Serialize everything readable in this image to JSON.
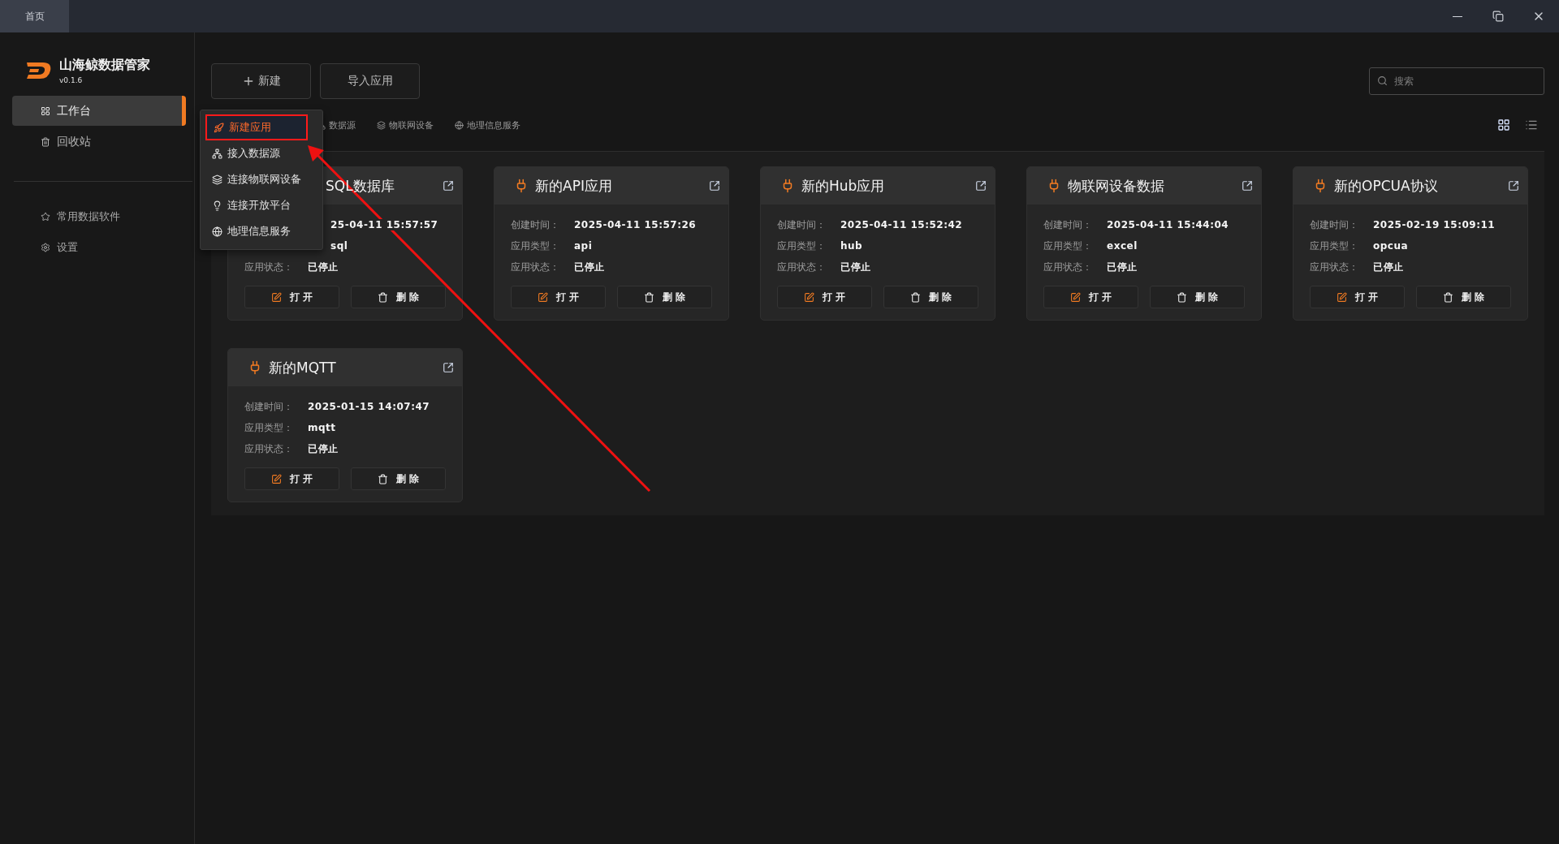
{
  "titlebar": {
    "tabs": [
      {
        "label": "首页",
        "selected": true
      }
    ]
  },
  "sidebar": {
    "app_name": "山海鲸数据管家",
    "version": "v0.1.6",
    "items": [
      {
        "label": "工作台",
        "selected": true
      },
      {
        "label": "回收站",
        "selected": false
      }
    ],
    "bottom_items": [
      {
        "label": "常用数据软件"
      },
      {
        "label": "设置"
      }
    ]
  },
  "toolbar": {
    "buttons": [
      {
        "label": "新建"
      },
      {
        "label": "导入应用"
      }
    ],
    "search": {
      "placeholder": "搜索"
    }
  },
  "filters": [
    {
      "label": "数据源"
    },
    {
      "label": "物联网设备"
    },
    {
      "label": "地理信息服务"
    }
  ],
  "view_modes": [
    {
      "selected": true
    },
    {
      "selected": false
    }
  ],
  "dropdown": {
    "items": [
      {
        "label": "新建应用",
        "selected": true,
        "outlined": true
      },
      {
        "label": "接入数据源",
        "selected": false,
        "outlined": false
      },
      {
        "label": "连接物联网设备",
        "selected": false,
        "outlined": false
      },
      {
        "label": "连接开放平台",
        "selected": false,
        "outlined": false
      },
      {
        "label": "地理信息服务",
        "selected": false,
        "outlined": false
      }
    ]
  },
  "cards": [
    {
      "title": "SQL数据库",
      "rows": [
        {
          "value": "25-04-11 15:57:57"
        },
        {
          "value": "sql"
        },
        {
          "label": "应用状态：",
          "value": "已停止"
        }
      ],
      "actions": [
        "打 开",
        "删 除"
      ]
    },
    {
      "title": "新的API应用",
      "rows": [
        {
          "label": "创建时间：",
          "value": "2025-04-11 15:57:26"
        },
        {
          "label": "应用类型：",
          "value": "api"
        },
        {
          "label": "应用状态：",
          "value": "已停止"
        }
      ],
      "actions": [
        "打 开",
        "删 除"
      ]
    },
    {
      "title": "新的Hub应用",
      "rows": [
        {
          "label": "创建时间：",
          "value": "2025-04-11 15:52:42"
        },
        {
          "label": "应用类型：",
          "value": "hub"
        },
        {
          "label": "应用状态：",
          "value": "已停止"
        }
      ],
      "actions": [
        "打 开",
        "删 除"
      ]
    },
    {
      "title": "物联网设备数据",
      "rows": [
        {
          "label": "创建时间：",
          "value": "2025-04-11 15:44:04"
        },
        {
          "label": "应用类型：",
          "value": "excel"
        },
        {
          "label": "应用状态：",
          "value": "已停止"
        }
      ],
      "actions": [
        "打 开",
        "删 除"
      ]
    },
    {
      "title": "新的OPCUA协议",
      "rows": [
        {
          "label": "创建时间：",
          "value": "2025-02-19 15:09:11"
        },
        {
          "label": "应用类型：",
          "value": "opcua"
        },
        {
          "label": "应用状态：",
          "value": "已停止"
        }
      ],
      "actions": [
        "打 开",
        "删 除"
      ]
    },
    {
      "title": "新的MQTT",
      "rows": [
        {
          "label": "创建时间：",
          "value": "2025-01-15 14:07:47"
        },
        {
          "label": "应用类型：",
          "value": "mqtt"
        },
        {
          "label": "应用状态：",
          "value": "已停止"
        }
      ],
      "actions": [
        "打 开",
        "删 除"
      ]
    }
  ]
}
